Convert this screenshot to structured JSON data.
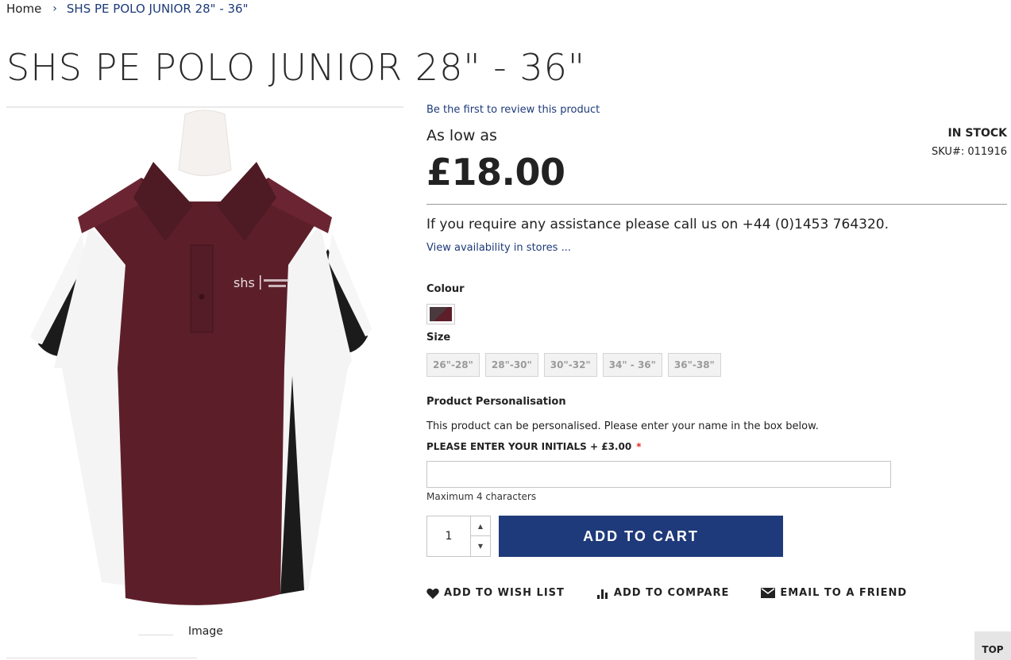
{
  "breadcrumb": {
    "home": "Home",
    "separator": "›",
    "current": "SHS PE POLO JUNIOR 28\" - 36\""
  },
  "product": {
    "title": "SHS PE POLO JUNIOR 28\" - 36\"",
    "review_link": "Be the first to review this product",
    "price_prefix": "As low as",
    "price": "£18.00",
    "stock_status": "IN STOCK",
    "sku_label": "SKU#:",
    "sku_value": "011916",
    "assistance_text": "If you require any assistance please call us on +44 (0)1453 764320.",
    "availability_link": "View availability in stores ...",
    "image_caption": "Image"
  },
  "options": {
    "colour_label": "Colour",
    "size_label": "Size",
    "sizes": [
      "26\"-28\"",
      "28\"-30\"",
      "30\"-32\"",
      "34\" - 36\"",
      "36\"-38\""
    ]
  },
  "personalisation": {
    "title": "Product Personalisation",
    "description": "This product can be personalised.  Please enter your name in the box below.",
    "field_label": "PLEASE ENTER YOUR INITIALS + £3.00",
    "required_mark": "*",
    "input_value": "",
    "max_note": "Maximum 4 characters"
  },
  "cart": {
    "quantity": "1",
    "add_to_cart": "ADD TO CART"
  },
  "actions": {
    "wishlist": "ADD TO WISH LIST",
    "compare": "ADD TO COMPARE",
    "email": "EMAIL TO A FRIEND"
  },
  "footer": {
    "top_button": "TOP"
  },
  "colors": {
    "brand_blue": "#1f3a7a",
    "link_blue": "#1d3a78",
    "required_red": "#e02b27",
    "shirt_maroon": "#5c1f2a"
  }
}
